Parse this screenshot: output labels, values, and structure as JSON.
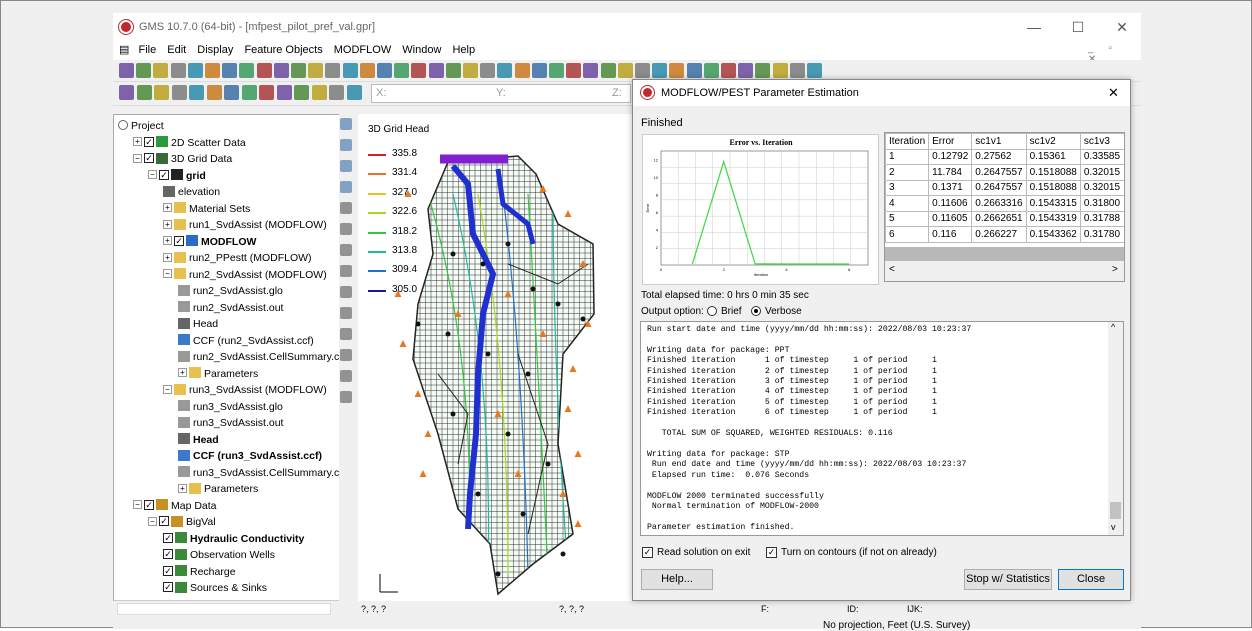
{
  "window": {
    "title": "GMS 10.7.0 (64-bit) - [mfpest_pilot_pref_val.gpr]"
  },
  "menu": [
    "File",
    "Edit",
    "Display",
    "Feature Objects",
    "MODFLOW",
    "Window",
    "Help"
  ],
  "coordbar": {
    "x": "X:",
    "y": "Y:",
    "z": "Z:"
  },
  "tree": [
    {
      "label": "Project",
      "lvl": 0,
      "icon": "project",
      "chk": false,
      "exp": false,
      "bold": false
    },
    {
      "label": "2D Scatter Data",
      "lvl": 1,
      "icon": "scatter",
      "chk": true,
      "exp": "+",
      "bold": false
    },
    {
      "label": "3D Grid Data",
      "lvl": 1,
      "icon": "grid3d",
      "chk": true,
      "exp": "-",
      "bold": false
    },
    {
      "label": "grid",
      "lvl": 2,
      "icon": "grid",
      "chk": true,
      "exp": "-",
      "bold": true
    },
    {
      "label": "elevation",
      "lvl": 3,
      "icon": "dataset",
      "chk": false,
      "exp": false,
      "bold": false
    },
    {
      "label": "Material Sets",
      "lvl": 3,
      "icon": "folder",
      "chk": false,
      "exp": "+",
      "bold": false
    },
    {
      "label": "run1_SvdAssist (MODFLOW)",
      "lvl": 3,
      "icon": "folder",
      "chk": false,
      "exp": "+",
      "bold": false
    },
    {
      "label": "MODFLOW",
      "lvl": 3,
      "icon": "modflow",
      "chk": true,
      "exp": "+",
      "bold": true
    },
    {
      "label": "run2_PPestt (MODFLOW)",
      "lvl": 3,
      "icon": "folder",
      "chk": false,
      "exp": "+",
      "bold": false
    },
    {
      "label": "run2_SvdAssist (MODFLOW)",
      "lvl": 3,
      "icon": "folder",
      "chk": false,
      "exp": "-",
      "bold": false
    },
    {
      "label": "run2_SvdAssist.glo",
      "lvl": 4,
      "icon": "file",
      "chk": false,
      "exp": false,
      "bold": false
    },
    {
      "label": "run2_SvdAssist.out",
      "lvl": 4,
      "icon": "file",
      "chk": false,
      "exp": false,
      "bold": false
    },
    {
      "label": "Head",
      "lvl": 4,
      "icon": "dataset",
      "chk": false,
      "exp": false,
      "bold": false
    },
    {
      "label": "CCF (run2_SvdAssist.ccf)",
      "lvl": 4,
      "icon": "ccf",
      "chk": false,
      "exp": false,
      "bold": false
    },
    {
      "label": "run2_SvdAssist.CellSummary.c",
      "lvl": 4,
      "icon": "file",
      "chk": false,
      "exp": false,
      "bold": false
    },
    {
      "label": "Parameters",
      "lvl": 4,
      "icon": "folder",
      "chk": false,
      "exp": "+",
      "bold": false
    },
    {
      "label": "run3_SvdAssist (MODFLOW)",
      "lvl": 3,
      "icon": "folder",
      "chk": false,
      "exp": "-",
      "bold": false
    },
    {
      "label": "run3_SvdAssist.glo",
      "lvl": 4,
      "icon": "file",
      "chk": false,
      "exp": false,
      "bold": false
    },
    {
      "label": "run3_SvdAssist.out",
      "lvl": 4,
      "icon": "file",
      "chk": false,
      "exp": false,
      "bold": false
    },
    {
      "label": "Head",
      "lvl": 4,
      "icon": "dataset",
      "chk": false,
      "exp": false,
      "bold": true
    },
    {
      "label": "CCF (run3_SvdAssist.ccf)",
      "lvl": 4,
      "icon": "ccf",
      "chk": false,
      "exp": false,
      "bold": true
    },
    {
      "label": "run3_SvdAssist.CellSummary.c",
      "lvl": 4,
      "icon": "file",
      "chk": false,
      "exp": false,
      "bold": false
    },
    {
      "label": "Parameters",
      "lvl": 4,
      "icon": "folder",
      "chk": false,
      "exp": "+",
      "bold": false
    },
    {
      "label": "Map Data",
      "lvl": 1,
      "icon": "map",
      "chk": true,
      "exp": "-",
      "bold": false
    },
    {
      "label": "BigVal",
      "lvl": 2,
      "icon": "map",
      "chk": true,
      "exp": "-",
      "bold": false
    },
    {
      "label": "Hydraulic Conductivity",
      "lvl": 3,
      "icon": "cov",
      "chk": true,
      "exp": false,
      "bold": true
    },
    {
      "label": "Observation Wells",
      "lvl": 3,
      "icon": "cov",
      "chk": true,
      "exp": false,
      "bold": false
    },
    {
      "label": "Recharge",
      "lvl": 3,
      "icon": "cov",
      "chk": true,
      "exp": false,
      "bold": false
    },
    {
      "label": "Sources & Sinks",
      "lvl": 3,
      "icon": "cov",
      "chk": true,
      "exp": false,
      "bold": false
    }
  ],
  "legend": {
    "title": "3D Grid Head",
    "items": [
      {
        "value": "335.8",
        "color": "#d62020"
      },
      {
        "value": "331.4",
        "color": "#e87020"
      },
      {
        "value": "327.0",
        "color": "#e8c020"
      },
      {
        "value": "322.6",
        "color": "#a8d820"
      },
      {
        "value": "318.2",
        "color": "#30c840"
      },
      {
        "value": "313.8",
        "color": "#20b8a0"
      },
      {
        "value": "309.4",
        "color": "#2070d0"
      },
      {
        "value": "305.0",
        "color": "#1818a0"
      }
    ]
  },
  "status": {
    "a": "?, ?, ?",
    "b": "?, ?, ?",
    "f": "F:",
    "id": "ID:",
    "ijk": "IJK:",
    "projection": "No projection, Feet (U.S. Survey)"
  },
  "dialog": {
    "title": "MODFLOW/PEST Parameter Estimation",
    "status": "Finished",
    "chart": {
      "title": "Error vs. Iteration",
      "xlabel": "Iteration",
      "ylabel": "Error"
    },
    "table": {
      "headers": [
        "Iteration",
        "Error",
        "sc1v1",
        "sc1v2",
        "sc1v3"
      ],
      "rows": [
        [
          "1",
          "0.12792",
          "0.27562",
          "0.15361",
          "0.33585"
        ],
        [
          "2",
          "11.784",
          "0.2647557",
          "0.1518088",
          "0.32015"
        ],
        [
          "3",
          "0.1371",
          "0.2647557",
          "0.1518088",
          "0.32015"
        ],
        [
          "4",
          "0.11606",
          "0.2663316",
          "0.1543315",
          "0.31800"
        ],
        [
          "5",
          "0.11605",
          "0.2662651",
          "0.1543319",
          "0.31788"
        ],
        [
          "6",
          "0.116",
          "0.266227",
          "0.1543362",
          "0.31780"
        ]
      ]
    },
    "elapsed": "Total elapsed time: 0 hrs 0 min 35 sec",
    "output_option": "Output option:",
    "brief": "Brief",
    "verbose": "Verbose",
    "log": "Run start date and time (yyyy/mm/dd hh:mm:ss): 2022/08/03 10:23:37\n\nWriting data for package: PPT\nFinished iteration      1 of timestep     1 of period     1\nFinished iteration      2 of timestep     1 of period     1\nFinished iteration      3 of timestep     1 of period     1\nFinished iteration      4 of timestep     1 of period     1\nFinished iteration      5 of timestep     1 of period     1\nFinished iteration      6 of timestep     1 of period     1\n\n   TOTAL SUM OF SQUARED, WEIGHTED RESIDUALS: 0.116\n\nWriting data for package: STP\n Run end date and time (yyyy/mm/dd hh:mm:ss): 2022/08/03 10:23:37\n Elapsed run time:  0.076 Seconds\n\nMODFLOW 2000 terminated successfully\n Normal termination of MODFLOW-2000\n\nParameter estimation finished.",
    "read_solution": "Read solution on exit",
    "turn_on_contours": "Turn on contours (if not on already)",
    "help": "Help...",
    "stop": "Stop w/ Statistics",
    "close": "Close"
  }
}
